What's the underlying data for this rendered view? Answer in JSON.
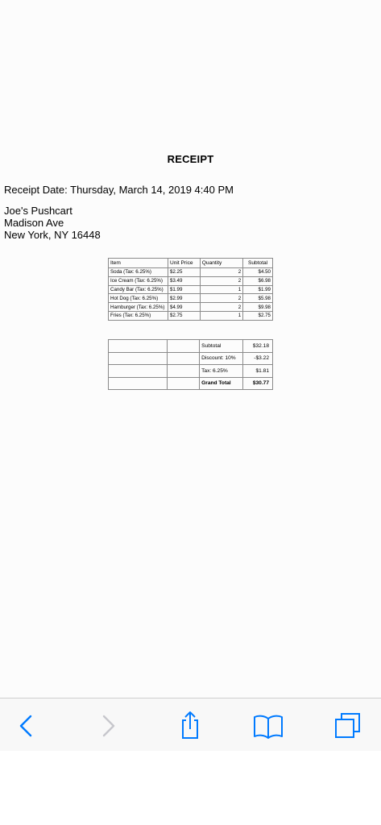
{
  "receipt": {
    "title": "RECEIPT",
    "date_line": "Receipt Date: Thursday, March 14, 2019 4:40 PM",
    "vendor": "Joe's Pushcart",
    "street": "Madison Ave",
    "city_line": "New York, NY 16448"
  },
  "table": {
    "headers": [
      "Item",
      "Unit Price",
      "Quantity",
      "Subtotal"
    ],
    "rows": [
      {
        "item": "Soda (Tax: 6.25%)",
        "unit_price": "$2.25",
        "quantity": "2",
        "subtotal": "$4.50"
      },
      {
        "item": "Ice Cream (Tax: 6.25%)",
        "unit_price": "$3.49",
        "quantity": "2",
        "subtotal": "$6.98"
      },
      {
        "item": "Candy Bar (Tax: 6.25%)",
        "unit_price": "$1.99",
        "quantity": "1",
        "subtotal": "$1.99"
      },
      {
        "item": "Hot Dog (Tax: 6.25%)",
        "unit_price": "$2.99",
        "quantity": "2",
        "subtotal": "$5.98"
      },
      {
        "item": "Hamburger (Tax: 6.25%)",
        "unit_price": "$4.99",
        "quantity": "2",
        "subtotal": "$9.98"
      },
      {
        "item": "Fries (Tax: 6.25%)",
        "unit_price": "$2.75",
        "quantity": "1",
        "subtotal": "$2.75"
      }
    ]
  },
  "totals": {
    "subtotal_label": "Subtotal",
    "subtotal_value": "$32.18",
    "discount_label": "Discount: 10%",
    "discount_value": "-$3.22",
    "tax_label": "Tax: 6.25%",
    "tax_value": "$1.81",
    "grand_label": "Grand Total",
    "grand_value": "$30.77"
  },
  "toolbar": {
    "accent_color": "#007aff",
    "disabled_color": "#c7c7cc",
    "buttons": [
      "back-icon",
      "forward-icon",
      "share-icon",
      "bookmarks-icon",
      "tabs-icon"
    ]
  }
}
